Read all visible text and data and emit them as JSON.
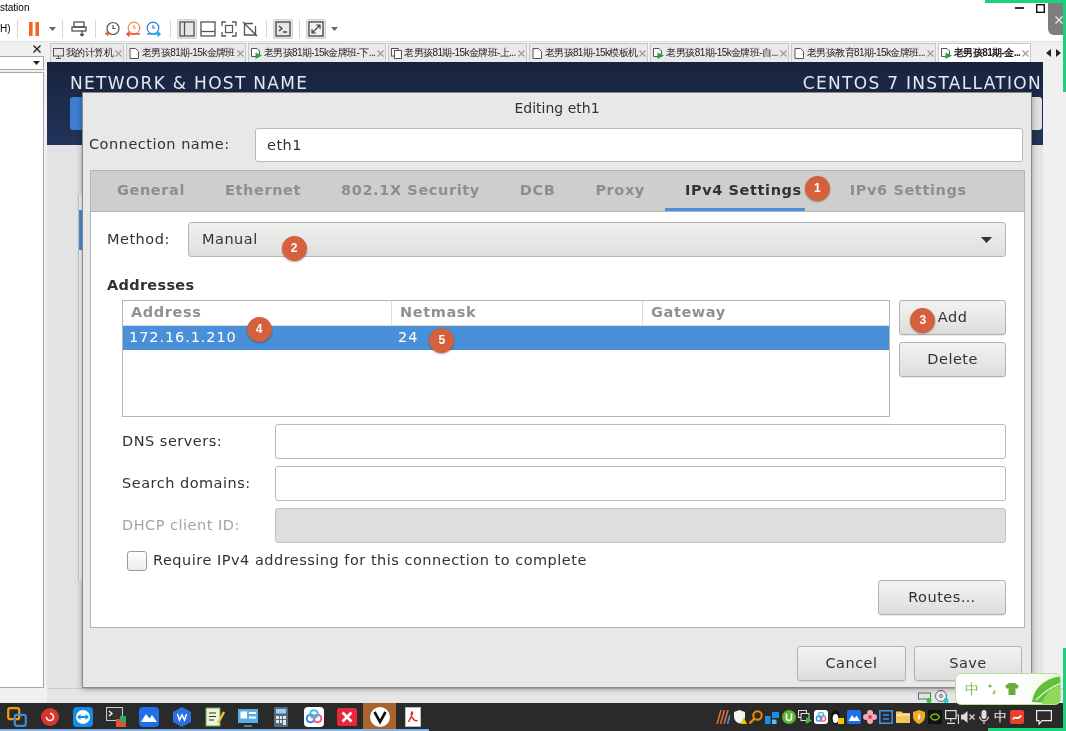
{
  "window": {
    "title": "station",
    "menu_fragment": "H)"
  },
  "toolbar": {
    "groups": [
      [
        {
          "kind": "pause",
          "on": false
        }
      ],
      [
        {
          "kind": "send-keys",
          "on": false
        }
      ],
      [
        {
          "kind": "snapshot",
          "on": false
        },
        {
          "kind": "revert",
          "on": false
        },
        {
          "kind": "snapshot-manager",
          "on": false
        }
      ],
      [
        {
          "kind": "library-view",
          "on": true
        },
        {
          "kind": "thumbnail-view",
          "on": false
        },
        {
          "kind": "full-screen",
          "on": false
        },
        {
          "kind": "unity",
          "on": false
        }
      ],
      [
        {
          "kind": "console",
          "on": true
        }
      ],
      [
        {
          "kind": "stretch",
          "on": true
        }
      ]
    ]
  },
  "vm_tabs": [
    {
      "label": "我的计算机",
      "kind": "home",
      "selected": false
    },
    {
      "label": "老男孩81期-15k金牌班",
      "kind": "vm",
      "selected": false
    },
    {
      "label": "老男孩81期-15k金牌班-下...",
      "kind": "vm-running",
      "selected": false
    },
    {
      "label": "老男孩81期-15k金牌班-上...",
      "kind": "clone",
      "selected": false
    },
    {
      "label": "老男孩81期-15k模板机",
      "kind": "vm",
      "selected": false
    },
    {
      "label": "老男孩81期-15k金牌班-自...",
      "kind": "vm-running",
      "selected": false
    },
    {
      "label": "老男孩教育81期-15k金牌班...",
      "kind": "vm",
      "selected": false
    },
    {
      "label": "老男孩81期-金...",
      "kind": "vm-running",
      "selected": true
    }
  ],
  "installer": {
    "heading": "NETWORK & HOST NAME",
    "product": "CENTOS 7 INSTALLATION"
  },
  "dialog": {
    "title": "Editing eth1",
    "connection_label": "Connection name:",
    "connection_name": "eth1",
    "tabs": [
      {
        "label": "General",
        "selected": false
      },
      {
        "label": "Ethernet",
        "selected": false
      },
      {
        "label": "802.1X Security",
        "selected": false
      },
      {
        "label": "DCB",
        "selected": false
      },
      {
        "label": "Proxy",
        "selected": false
      },
      {
        "label": "IPv4 Settings",
        "selected": true,
        "marker": "1"
      },
      {
        "label": "IPv6 Settings",
        "selected": false
      }
    ],
    "method": {
      "label": "Method:",
      "value": "Manual",
      "marker": "2"
    },
    "addresses": {
      "heading": "Addresses",
      "columns": [
        "Address",
        "Netmask",
        "Gateway"
      ],
      "rows": [
        {
          "selected": true,
          "cells": [
            {
              "text": "172.16.1.210",
              "marker": "4"
            },
            {
              "text": "24",
              "marker": "5"
            }
          ]
        }
      ],
      "buttons": [
        {
          "label": "Add",
          "marker": "3"
        },
        {
          "label": "Delete"
        }
      ]
    },
    "fields": [
      {
        "label": "DNS servers:",
        "disabled": false
      },
      {
        "label": "Search domains:",
        "disabled": false
      },
      {
        "label": "DHCP client ID:",
        "disabled": true
      }
    ],
    "require": {
      "label": "Require IPv4 addressing for this connection to complete",
      "checked": false
    },
    "routes_button": "Routes…",
    "footer_buttons": [
      "Cancel",
      "Save"
    ]
  },
  "taskbar": {
    "apps": [
      {
        "kind": "squares",
        "selected": false,
        "running": true
      },
      {
        "kind": "shell",
        "selected": false,
        "running": true
      },
      {
        "kind": "arrows",
        "selected": false,
        "running": true
      },
      {
        "kind": "terminal",
        "selected": false,
        "running": true
      },
      {
        "kind": "mountain",
        "selected": false,
        "running": true
      },
      {
        "kind": "hexagon",
        "selected": false,
        "running": true
      },
      {
        "kind": "notepad",
        "selected": false,
        "running": true
      },
      {
        "kind": "screen",
        "selected": false,
        "running": true
      },
      {
        "kind": "calculator",
        "selected": false,
        "running": true
      },
      {
        "kind": "rings",
        "selected": false,
        "running": true
      },
      {
        "kind": "cross",
        "selected": false,
        "running": true
      },
      {
        "kind": "circle",
        "selected": true,
        "running": true
      },
      {
        "kind": "pdf",
        "selected": false,
        "running": true
      }
    ],
    "input_mode": "中"
  },
  "ime_bar": {
    "mode": "中"
  }
}
